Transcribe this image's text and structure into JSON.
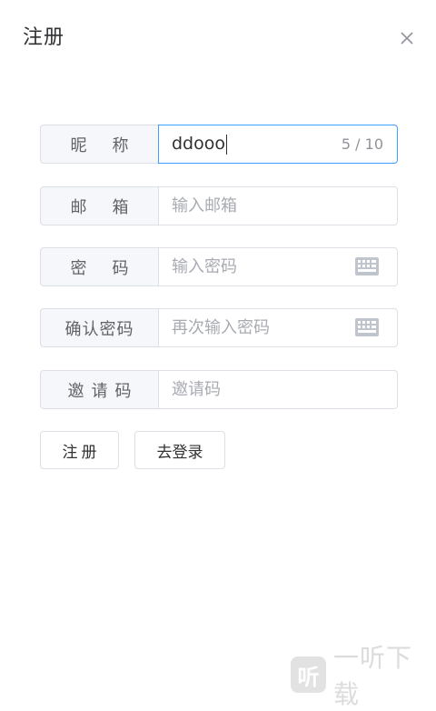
{
  "dialog": {
    "title": "注册"
  },
  "form": {
    "nickname": {
      "label": "昵称",
      "value": "ddooo",
      "counter": "5 / 10"
    },
    "email": {
      "label": "邮箱",
      "placeholder": "输入邮箱"
    },
    "password": {
      "label": "密码",
      "placeholder": "输入密码",
      "icon": "keyboard-icon"
    },
    "confirm_password": {
      "label": "确认密码",
      "placeholder": "再次输入密码",
      "icon": "keyboard-icon"
    },
    "invite_code": {
      "label": "邀请码",
      "placeholder": "邀请码"
    }
  },
  "buttons": {
    "register_label": "注册",
    "go_login_label": "去登录"
  },
  "watermark": {
    "logo_char": "听",
    "text": "一听下载"
  },
  "colors": {
    "focus_border": "#409eff",
    "border": "#dcdfe6",
    "prepend_bg": "#f5f7fa",
    "placeholder": "#a8abb2"
  }
}
